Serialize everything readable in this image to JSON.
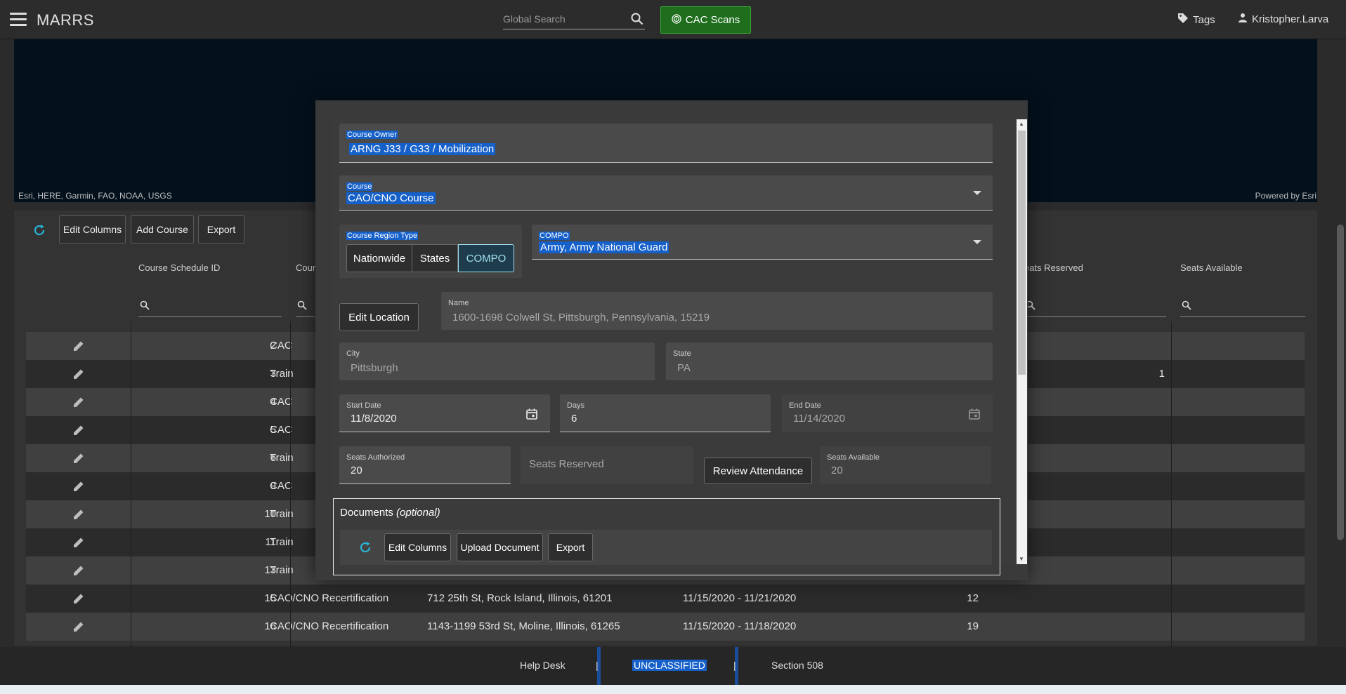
{
  "app": {
    "title": "MARRS"
  },
  "topbar": {
    "search_placeholder": "Global Search",
    "cac_label": "CAC Scans",
    "tags_label": "Tags",
    "user_label": "Kristopher.Larva"
  },
  "map": {
    "attribution": "Esri, HERE, Garmin, FAO, NOAA, USGS",
    "powered_by": "Powered by Esri"
  },
  "toolbar": {
    "edit_columns": "Edit Columns",
    "add_course": "Add Course",
    "export": "Export"
  },
  "table": {
    "columns": [
      "Course Schedule ID",
      "Cours",
      "eats Reserved",
      "Seats Available"
    ],
    "rows": [
      {
        "id": "2",
        "course": "CAC",
        "location": "",
        "dates": "",
        "seats_auth": "",
        "reserved": "",
        "available": ""
      },
      {
        "id": "3",
        "course": "Train",
        "location": "",
        "dates": "",
        "seats_auth": "",
        "reserved": "1",
        "available": ""
      },
      {
        "id": "4",
        "course": "CAC",
        "location": "",
        "dates": "",
        "seats_auth": "",
        "reserved": "",
        "available": ""
      },
      {
        "id": "5",
        "course": "CAC",
        "location": "",
        "dates": "",
        "seats_auth": "",
        "reserved": "",
        "available": ""
      },
      {
        "id": "6",
        "course": "Train",
        "location": "",
        "dates": "",
        "seats_auth": "",
        "reserved": "",
        "available": ""
      },
      {
        "id": "9",
        "course": "CAC",
        "location": "",
        "dates": "",
        "seats_auth": "",
        "reserved": "",
        "available": ""
      },
      {
        "id": "10",
        "course": "Train",
        "location": "",
        "dates": "",
        "seats_auth": "",
        "reserved": "",
        "available": ""
      },
      {
        "id": "11",
        "course": "Train",
        "location": "",
        "dates": "",
        "seats_auth": "",
        "reserved": "",
        "available": ""
      },
      {
        "id": "13",
        "course": "Train",
        "location": "",
        "dates": "",
        "seats_auth": "",
        "reserved": "",
        "available": ""
      },
      {
        "id": "15",
        "course": "CAO/CNO Recertification",
        "location": "712 25th St, Rock Island, Illinois, 61201",
        "dates": "11/15/2020 - 11/21/2020",
        "seats_auth": "12",
        "reserved": "",
        "available": ""
      },
      {
        "id": "16",
        "course": "CAO/CNO Recertification",
        "location": "1143-1199 53rd St, Moline, Illinois, 61265",
        "dates": "11/15/2020 - 11/18/2020",
        "seats_auth": "19",
        "reserved": "",
        "available": ""
      }
    ]
  },
  "modal": {
    "course_owner_label": "Course Owner",
    "course_owner_value": "ARNG J33 / G33 / Mobilization",
    "course_label": "Course",
    "course_value": "CAO/CNO Course",
    "region_type_label": "Course Region Type",
    "region_options": [
      "Nationwide",
      "States",
      "COMPO"
    ],
    "region_selected": "COMPO",
    "compo_label": "COMPO",
    "compo_value": "Army, Army National Guard",
    "edit_location": "Edit Location",
    "name_label": "Name",
    "name_value": "1600-1698 Colwell St, Pittsburgh, Pennsylvania, 15219",
    "city_label": "City",
    "city_value": "Pittsburgh",
    "state_label": "State",
    "state_value": "PA",
    "start_date_label": "Start Date",
    "start_date_value": "11/8/2020",
    "days_label": "Days",
    "days_value": "6",
    "end_date_label": "End Date",
    "end_date_value": "11/14/2020",
    "seats_authorized_label": "Seats Authorized",
    "seats_authorized_value": "20",
    "seats_reserved_label": "Seats Reserved",
    "review_attendance": "Review Attendance",
    "seats_available_label": "Seats Available",
    "seats_available_value": "20",
    "documents_title": "Documents",
    "documents_optional": "(optional)",
    "docs_edit_columns": "Edit Columns",
    "docs_upload": "Upload Document",
    "docs_export": "Export"
  },
  "footer": {
    "help": "Help Desk",
    "sep": "|",
    "classification": "UNCLASSIFIED",
    "section": "Section 508"
  },
  "colors": {
    "accent_green": "#1e6e1e",
    "selection_blue": "#1560c9",
    "refresh_cyan": "#29b6d8"
  }
}
